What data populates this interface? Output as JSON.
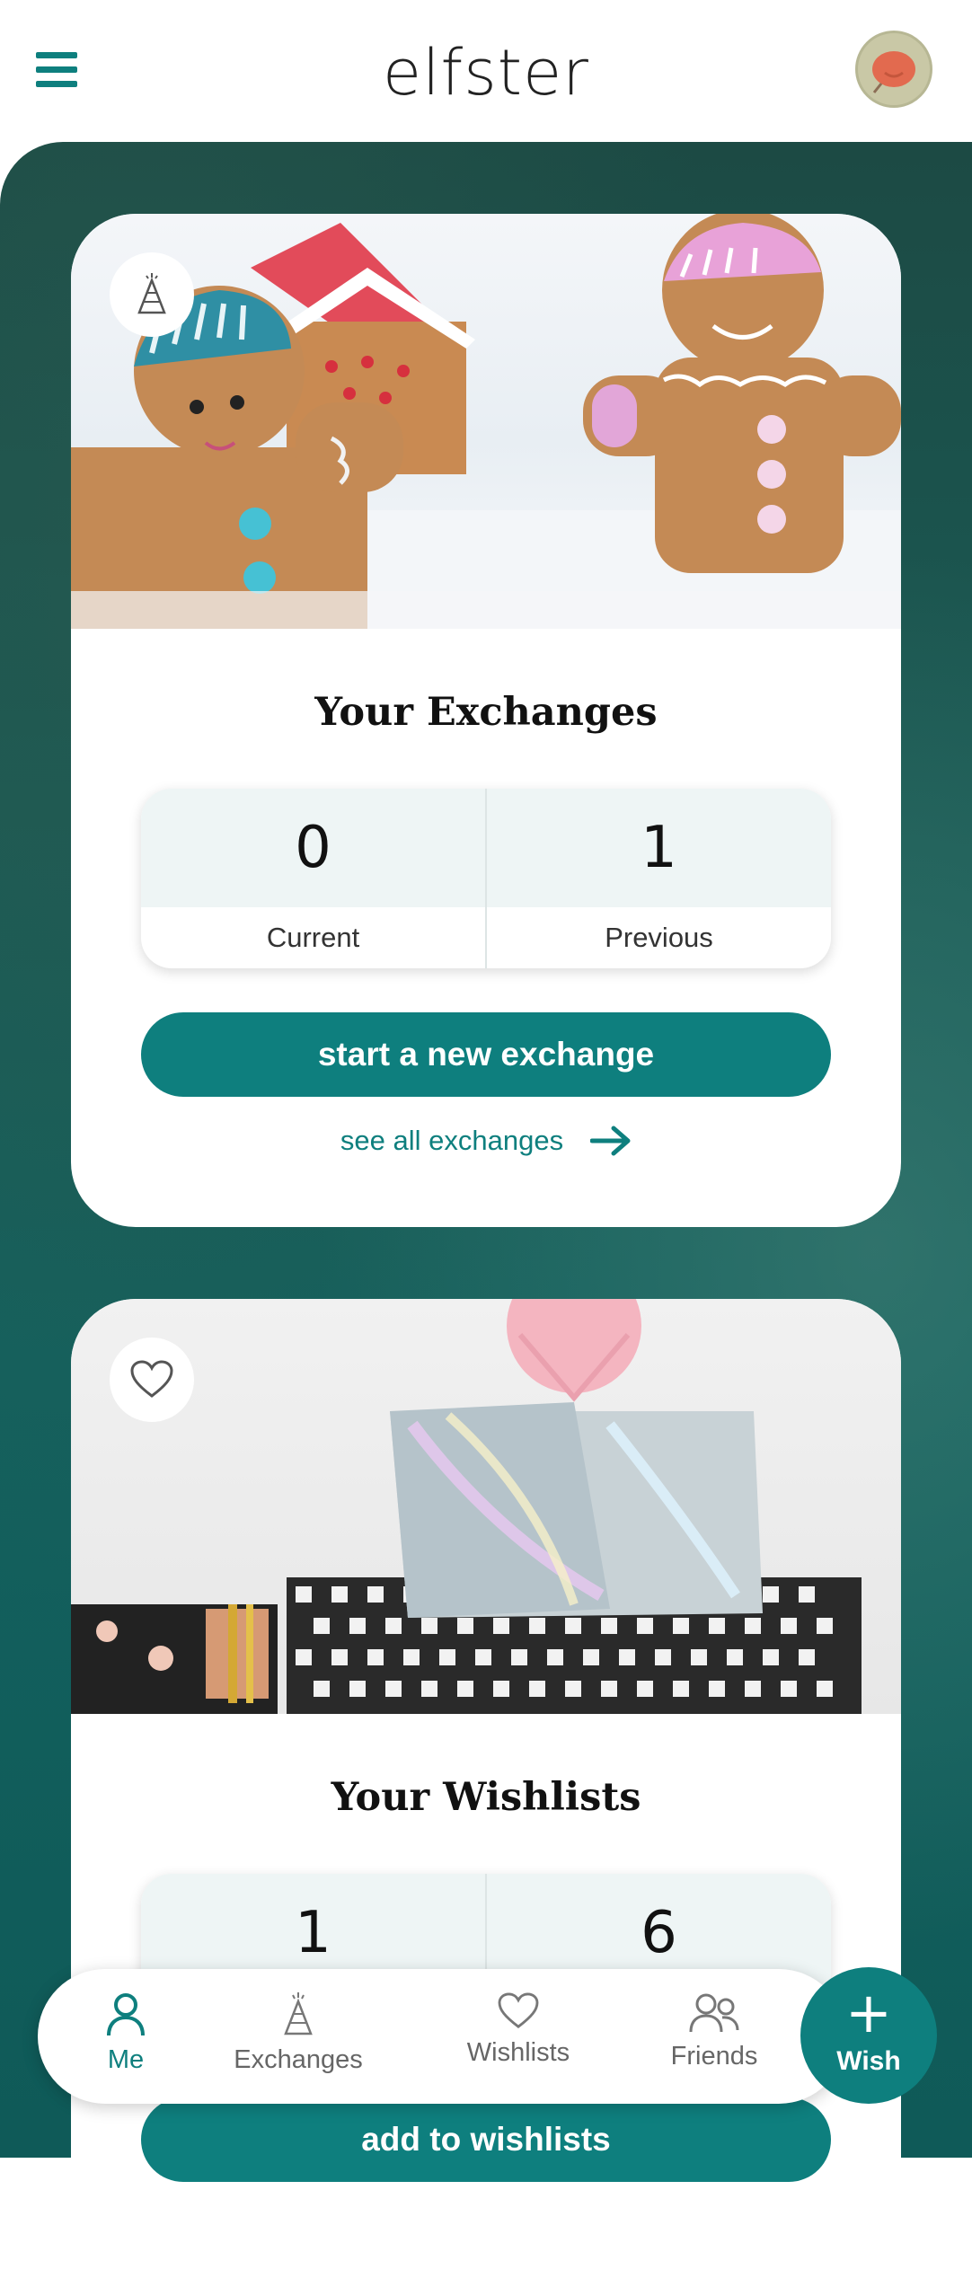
{
  "header": {
    "logo": "elfster",
    "menu_icon": "hamburger-menu-icon",
    "avatar_icon": "user-avatar"
  },
  "exchanges_card": {
    "badge_icon": "party-hat-icon",
    "title": "Your Exchanges",
    "stats": [
      {
        "value": "0",
        "label": "Current"
      },
      {
        "value": "1",
        "label": "Previous"
      }
    ],
    "primary_button": "start a new exchange",
    "see_all": "see all exchanges",
    "see_all_icon": "arrow-right-icon"
  },
  "wishlists_card": {
    "badge_icon": "heart-icon",
    "title": "Your Wishlists",
    "stats": [
      {
        "value": "1",
        "label": ""
      },
      {
        "value": "6",
        "label": ""
      }
    ],
    "primary_button": "add to wishlists"
  },
  "bottom_nav": {
    "items": [
      {
        "label": "Me",
        "icon": "person-icon",
        "active": true
      },
      {
        "label": "Exchanges",
        "icon": "party-hat-icon",
        "active": false
      },
      {
        "label": "Wishlists",
        "icon": "heart-icon",
        "active": false
      },
      {
        "label": "Friends",
        "icon": "people-icon",
        "active": false
      }
    ],
    "fab": {
      "label": "Wish",
      "icon": "plus-icon"
    }
  },
  "colors": {
    "accent": "#0e7f7e",
    "background": "#1a5b55",
    "stat_bg": "#eef5f5"
  }
}
